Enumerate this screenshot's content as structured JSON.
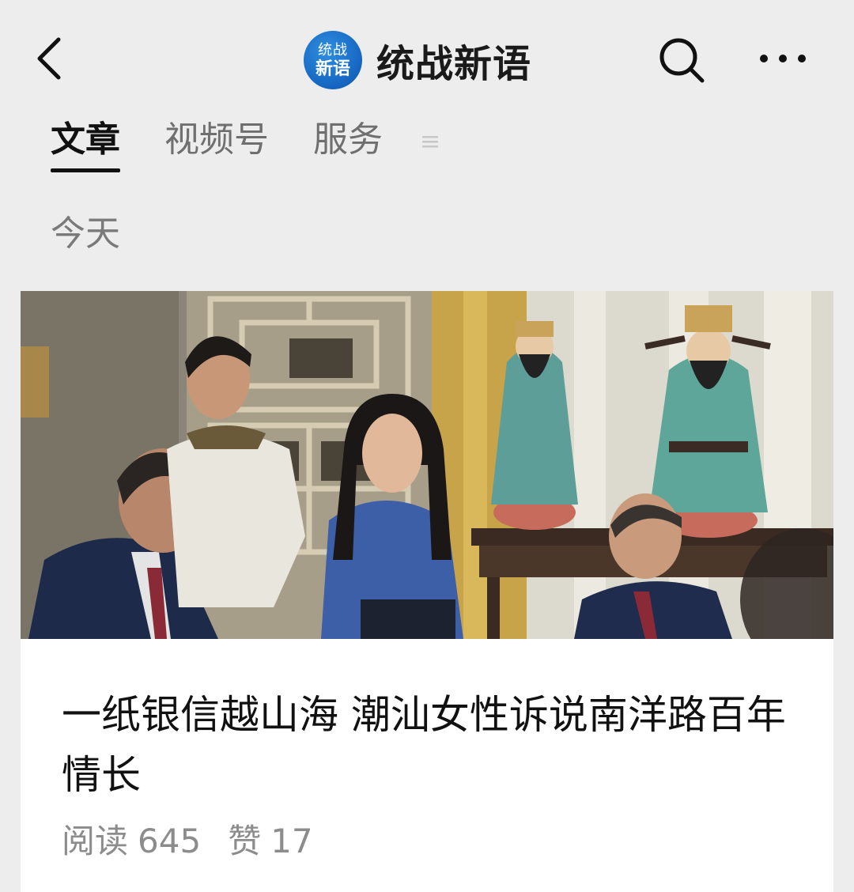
{
  "header": {
    "account_name": "统战新语",
    "avatar_text_line1": "统战",
    "avatar_text_line2": "新语"
  },
  "icons": {
    "back": "chevron-left-icon",
    "search": "search-icon",
    "more": "more-horizontal-icon",
    "tab_menu": "menu-lines-icon"
  },
  "tabs": [
    {
      "label": "文章",
      "active": true
    },
    {
      "label": "视频号",
      "active": false
    },
    {
      "label": "服务",
      "active": false
    }
  ],
  "feed": {
    "date_label": "今天",
    "article": {
      "title": "一纸银信越山海 潮汕女性诉说南洋路百年情长",
      "read_label": "阅读",
      "read_count": "645",
      "like_label": "赞",
      "like_count": "17"
    }
  },
  "colors": {
    "background": "#ededed",
    "card": "#ffffff",
    "avatar_blue": "#1565c0",
    "text_primary": "#111111",
    "text_secondary": "#8c8c8c"
  }
}
